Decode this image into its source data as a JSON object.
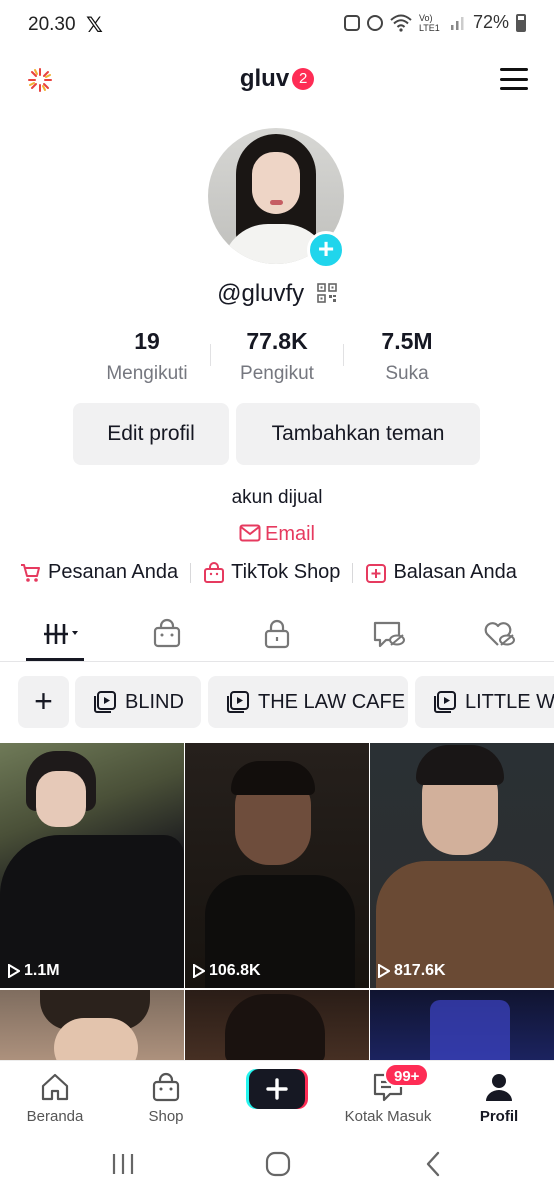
{
  "status_bar": {
    "time": "20.30",
    "x_icon": "x-logo-icon",
    "network": "Vo) LTE1",
    "battery": "72%"
  },
  "header": {
    "title": "gluv",
    "badge_count": "2"
  },
  "profile": {
    "username": "@gluvfy",
    "bio": "akun dijual",
    "email_label": "Email"
  },
  "stats": [
    {
      "value": "19",
      "label": "Mengikuti"
    },
    {
      "value": "77.8K",
      "label": "Pengikut"
    },
    {
      "value": "7.5M",
      "label": "Suka"
    }
  ],
  "buttons": {
    "edit_profile": "Edit profil",
    "add_friends": "Tambahkan teman"
  },
  "links": [
    {
      "label": "Pesanan Anda",
      "icon": "cart-icon"
    },
    {
      "label": "TikTok Shop",
      "icon": "shop-bag-icon"
    },
    {
      "label": "Balasan Anda",
      "icon": "reply-icon"
    }
  ],
  "tabs": [
    "videos-grid-icon",
    "shop-bag-icon",
    "lock-icon",
    "hidden-video-icon",
    "liked-hidden-icon"
  ],
  "playlists": [
    "BLIND",
    "THE LAW CAFE",
    "LITTLE WO"
  ],
  "videos": [
    {
      "views": "1.1M"
    },
    {
      "views": "106.8K"
    },
    {
      "views": "817.6K"
    }
  ],
  "bottom_nav": [
    {
      "label": "Beranda",
      "icon": "home-icon"
    },
    {
      "label": "Shop",
      "icon": "shop-bag-icon"
    },
    {
      "label": "",
      "icon": "create-plus-icon"
    },
    {
      "label": "Kotak Masuk",
      "icon": "inbox-icon",
      "badge": "99+"
    },
    {
      "label": "Profil",
      "icon": "profile-icon"
    }
  ],
  "colors": {
    "accent": "#fe2c55",
    "teal": "#20d5ec",
    "email": "#e63a5f"
  }
}
